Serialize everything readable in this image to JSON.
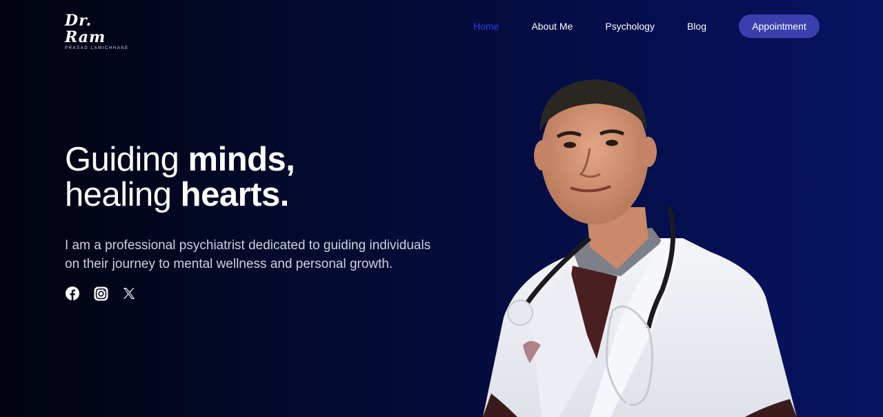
{
  "nav": {
    "logo": {
      "script": "Dr. Ram",
      "sub": "PRASAD LAMICHHANE"
    },
    "links": [
      {
        "label": "Home",
        "active": true
      },
      {
        "label": "About Me",
        "active": false
      },
      {
        "label": "Psychology",
        "active": false
      },
      {
        "label": "Blog",
        "active": false
      }
    ],
    "cta_label": "Appointment"
  },
  "hero": {
    "headline_line1_light": "Guiding ",
    "headline_line1_bold": "minds,",
    "headline_line2_light": "healing ",
    "headline_line2_bold": "hearts.",
    "description": "I am a professional psychiatrist dedicated to guiding individuals on their journey to mental wellness and personal growth."
  },
  "socials": [
    {
      "icon": "facebook-icon"
    },
    {
      "icon": "instagram-icon"
    },
    {
      "icon": "x-icon"
    }
  ],
  "colors": {
    "active_link": "#2b3fe0",
    "cta_bg": "#3a3fae",
    "background_left": "#01030f",
    "background_right": "#061463"
  }
}
